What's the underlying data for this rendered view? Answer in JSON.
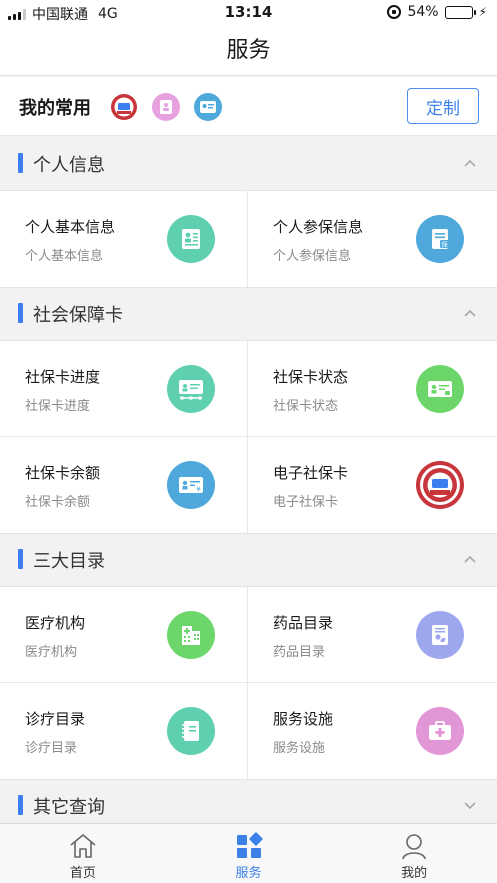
{
  "status_bar": {
    "carrier": "中国联通",
    "network": "4G",
    "time": "13:14",
    "battery": "54%",
    "battery_level": 0.54
  },
  "header": {
    "title": "服务"
  },
  "favorites": {
    "label": "我的常用",
    "icons": [
      "social-security-card-badge-icon",
      "profile-card-icon",
      "id-card-icon"
    ],
    "customize_label": "定制"
  },
  "sections": [
    {
      "title": "个人信息",
      "expanded": true,
      "items": [
        {
          "name": "个人基本信息",
          "sub": "个人基本信息",
          "icon": "person-document-icon",
          "color": "#5ed0b0"
        },
        {
          "name": "个人参保信息",
          "sub": "个人参保信息",
          "icon": "insurance-document-icon",
          "color": "#4ea8dc"
        }
      ]
    },
    {
      "title": "社会保障卡",
      "expanded": true,
      "items": [
        {
          "name": "社保卡进度",
          "sub": "社保卡进度",
          "icon": "card-progress-icon",
          "color": "#5ed0b0"
        },
        {
          "name": "社保卡状态",
          "sub": "社保卡状态",
          "icon": "card-status-icon",
          "color": "#6dd66a"
        },
        {
          "name": "社保卡余额",
          "sub": "社保卡余额",
          "icon": "card-balance-icon",
          "color": "#4ea8dc"
        },
        {
          "name": "电子社保卡",
          "sub": "电子社保卡",
          "icon": "e-social-card-badge-icon",
          "color": "#c8353b"
        }
      ]
    },
    {
      "title": "三大目录",
      "expanded": true,
      "items": [
        {
          "name": "医疗机构",
          "sub": "医疗机构",
          "icon": "hospital-icon",
          "color": "#6dd66a"
        },
        {
          "name": "药品目录",
          "sub": "药品目录",
          "icon": "medicine-list-icon",
          "color": "#9ea6ee"
        },
        {
          "name": "诊疗目录",
          "sub": "诊疗目录",
          "icon": "treatment-notebook-icon",
          "color": "#5ed0b0"
        },
        {
          "name": "服务设施",
          "sub": "服务设施",
          "icon": "first-aid-kit-icon",
          "color": "#e196d6"
        }
      ]
    },
    {
      "title": "其它查询",
      "expanded": false,
      "items": []
    }
  ],
  "tabs": [
    {
      "label": "首页",
      "icon": "home-icon",
      "active": false
    },
    {
      "label": "服务",
      "icon": "services-grid-icon",
      "active": true
    },
    {
      "label": "我的",
      "icon": "user-icon",
      "active": false
    }
  ],
  "colors": {
    "accent": "#3d80e8",
    "section_bar": "#3d7ff0",
    "battery_fill": "#f5c33b"
  }
}
